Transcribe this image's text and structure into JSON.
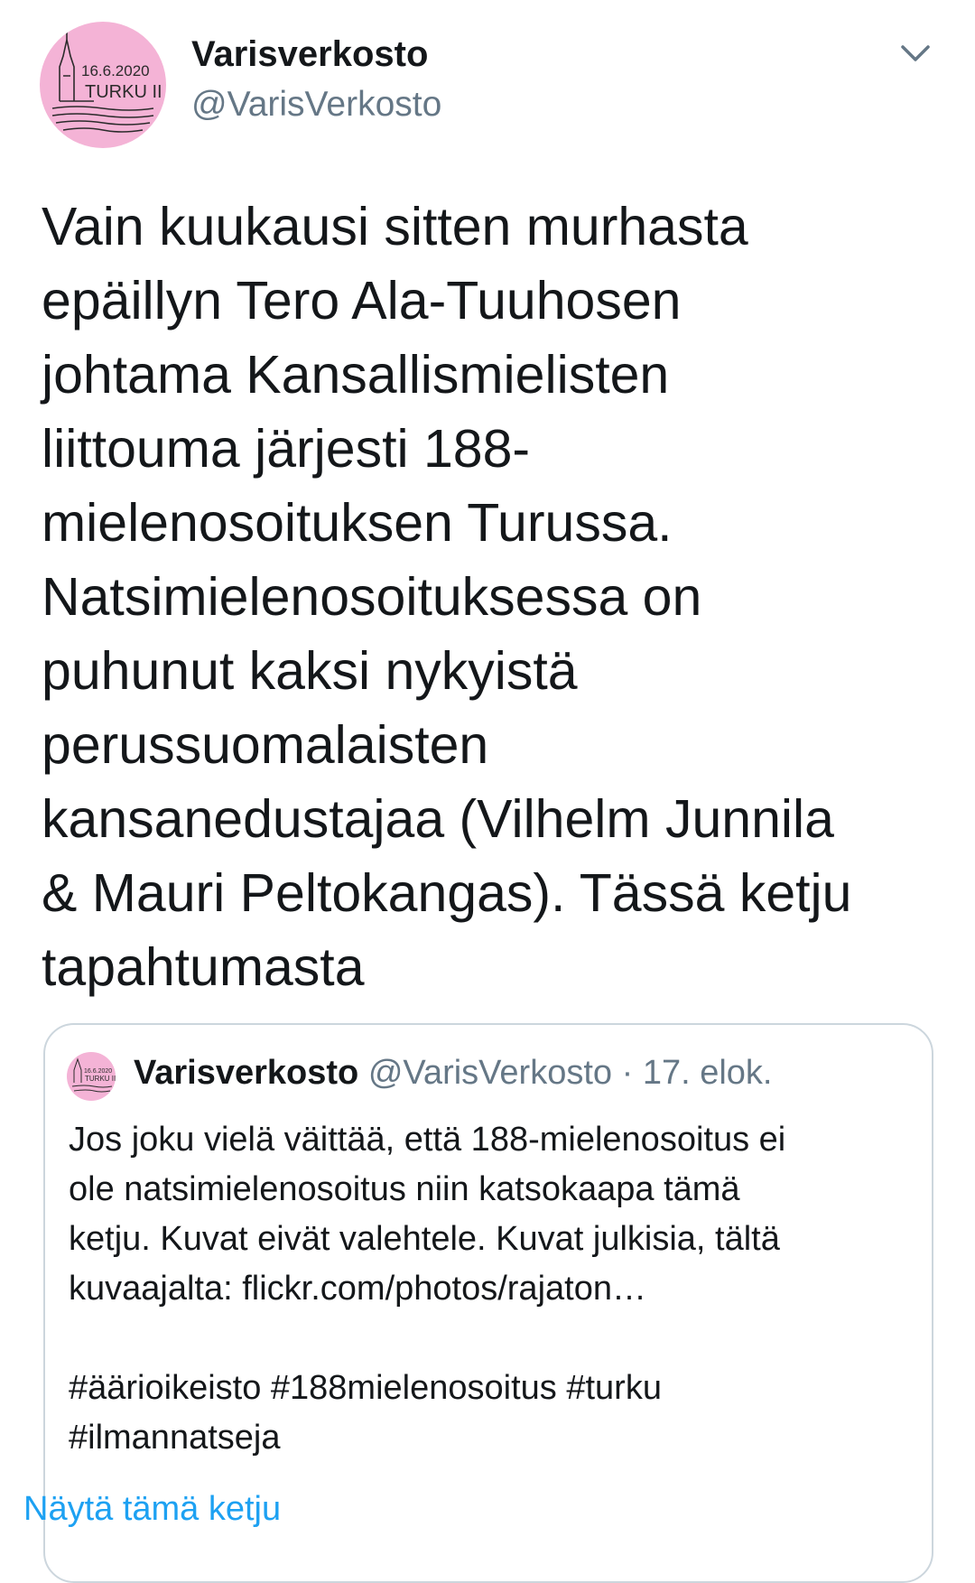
{
  "tweet": {
    "author": {
      "name": "Varisverkosto",
      "handle": "@VarisVerkosto",
      "avatar_text": [
        "16.6.2020",
        "TURKU II"
      ],
      "avatar_icon": "church-tower-logo-icon"
    },
    "menu_icon": "chevron-down-icon",
    "text_lines": [
      "Vain kuukausi sitten murhasta",
      "epäillyn Tero Ala-Tuuhosen",
      "johtama Kansallismielisten",
      "liittouma järjesti 188-",
      "mielenosoituksen Turussa.",
      "Natsimielenosoituksessa on",
      "puhunut kaksi nykyistä",
      "perussuomalaisten",
      "kansanedustajaa (Vilhelm Junnila",
      "& Mauri Peltokangas). Tässä ketju",
      "tapahtumasta"
    ]
  },
  "quoted": {
    "name": "Varisverkosto",
    "handle": "@VarisVerkosto",
    "separator": "·",
    "date": "17. elok.",
    "avatar_text": [
      "16.6.2020",
      "TURKU II"
    ],
    "text_lines": [
      "Jos joku vielä väittää, että 188-mielenosoitus ei",
      "ole natsimielenosoitus niin katsokaapa tämä",
      "ketju. Kuvat eivät valehtele. Kuvat julkisia, tältä",
      "kuvaajalta: flickr.com/photos/rajaton…",
      "",
      "#äärioikeisto #188mielenosoitus #turku",
      "#ilmannatseja"
    ],
    "show_thread_label": "Näytä tämä ketju"
  },
  "colors": {
    "text": "#14171a",
    "secondary": "#657786",
    "link": "#1da1f2",
    "avatar_bg": "#f4b3d6",
    "border": "#ccd6dd"
  }
}
